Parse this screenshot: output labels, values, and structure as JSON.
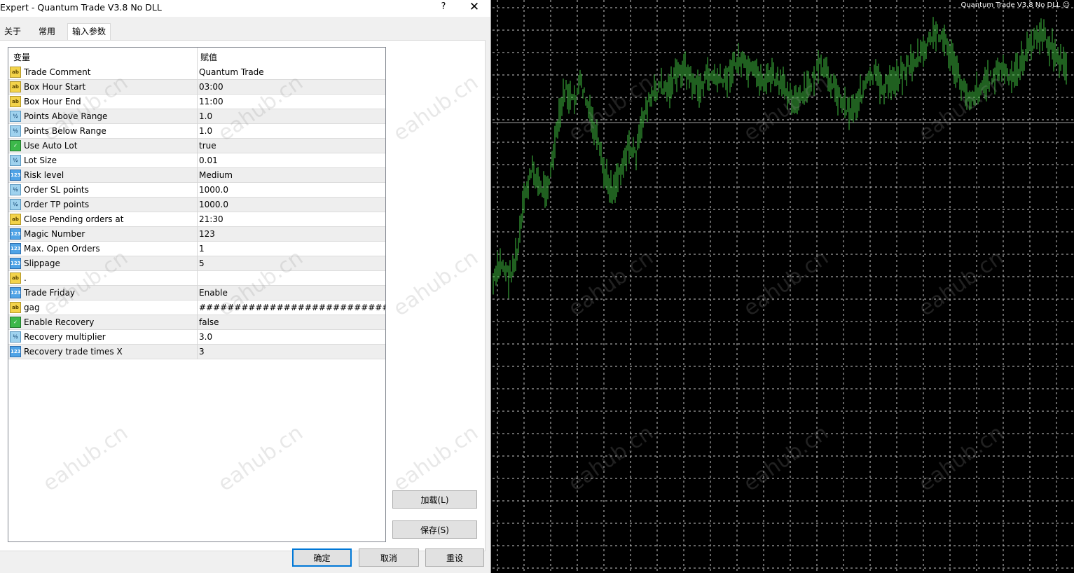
{
  "dialog": {
    "title": "Expert - Quantum Trade V3.8 No DLL",
    "help": "?",
    "close": "✕",
    "tabs": [
      "关于",
      "常用",
      "输入参数"
    ],
    "active_tab": "输入参数",
    "grid": {
      "col_variable": "变量",
      "col_value": "赋值",
      "rows": [
        {
          "icon": "string-icon",
          "badge": "ab",
          "name": "Trade Comment",
          "value": "Quantum Trade"
        },
        {
          "icon": "string-icon",
          "badge": "ab",
          "name": "Box Hour Start",
          "value": "03:00"
        },
        {
          "icon": "string-icon",
          "badge": "ab",
          "name": "Box Hour End",
          "value": "11:00"
        },
        {
          "icon": "double-icon",
          "badge": "½",
          "name": "Points Above Range",
          "value": "1.0"
        },
        {
          "icon": "double-icon",
          "badge": "½",
          "name": "Points Below Range",
          "value": "1.0"
        },
        {
          "icon": "bool-icon",
          "badge": "✓",
          "name": "Use Auto Lot",
          "value": "true"
        },
        {
          "icon": "double-icon",
          "badge": "½",
          "name": "Lot Size",
          "value": "0.01"
        },
        {
          "icon": "int-icon",
          "badge": "123",
          "name": "Risk level",
          "value": "Medium"
        },
        {
          "icon": "double-icon",
          "badge": "½",
          "name": "Order SL points",
          "value": "1000.0"
        },
        {
          "icon": "double-icon",
          "badge": "½",
          "name": "Order TP points",
          "value": "1000.0"
        },
        {
          "icon": "string-icon",
          "badge": "ab",
          "name": "Close Pending orders at",
          "value": "21:30"
        },
        {
          "icon": "int-icon",
          "badge": "123",
          "name": "Magic Number",
          "value": "123"
        },
        {
          "icon": "int-icon",
          "badge": "123",
          "name": "Max. Open Orders",
          "value": "1"
        },
        {
          "icon": "int-icon",
          "badge": "123",
          "name": "Slippage",
          "value": "5"
        },
        {
          "icon": "string-icon",
          "badge": "ab",
          "name": ".",
          "value": ""
        },
        {
          "icon": "int-icon",
          "badge": "123",
          "name": "Trade Friday",
          "value": "Enable"
        },
        {
          "icon": "string-icon",
          "badge": "ab",
          "name": "gag",
          "value": "############################## ..."
        },
        {
          "icon": "bool-icon",
          "badge": "✓",
          "name": "Enable Recovery",
          "value": "false"
        },
        {
          "icon": "double-icon",
          "badge": "½",
          "name": "Recovery multiplier",
          "value": "3.0"
        },
        {
          "icon": "int-icon",
          "badge": "123",
          "name": "Recovery trade times X",
          "value": "3"
        }
      ]
    },
    "buttons": {
      "load": "加载(L)",
      "save": "保存(S)",
      "ok": "确定",
      "cancel": "取消",
      "reset": "重设"
    }
  },
  "chart": {
    "title": "Quantum Trade V3.8 No DLL ☺",
    "colors": {
      "background": "#000000",
      "grid": "#c8c8c8",
      "bars": "#3fbf3f",
      "price_line": "#a0a0a0"
    },
    "price_series_shape": [
      0.3,
      0.36,
      0.32,
      0.38,
      0.55,
      0.62,
      0.56,
      0.58,
      0.72,
      0.84,
      0.8,
      0.86,
      0.78,
      0.7,
      0.6,
      0.56,
      0.62,
      0.68,
      0.66,
      0.78,
      0.82,
      0.85,
      0.84,
      0.88,
      0.9,
      0.86,
      0.84,
      0.88,
      0.87,
      0.86,
      0.9,
      0.92,
      0.89,
      0.88,
      0.86,
      0.88,
      0.85,
      0.84,
      0.8,
      0.82,
      0.86,
      0.9,
      0.88,
      0.84,
      0.8,
      0.78,
      0.82,
      0.86,
      0.88,
      0.84,
      0.86,
      0.88,
      0.9,
      0.92,
      0.94,
      0.98,
      1.0,
      0.96,
      0.9,
      0.84,
      0.82,
      0.84,
      0.86,
      0.88,
      0.9,
      0.86,
      0.9,
      0.94,
      0.98,
      0.99,
      0.96,
      0.92,
      0.9
    ]
  },
  "watermark": "eahub.cn"
}
